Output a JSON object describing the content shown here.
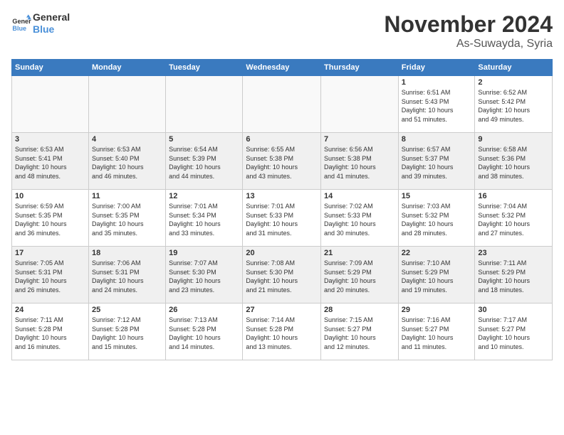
{
  "header": {
    "logo_line1": "General",
    "logo_line2": "Blue",
    "month_title": "November 2024",
    "subtitle": "As-Suwayda, Syria"
  },
  "days_of_week": [
    "Sunday",
    "Monday",
    "Tuesday",
    "Wednesday",
    "Thursday",
    "Friday",
    "Saturday"
  ],
  "weeks": [
    [
      {
        "day": "",
        "info": ""
      },
      {
        "day": "",
        "info": ""
      },
      {
        "day": "",
        "info": ""
      },
      {
        "day": "",
        "info": ""
      },
      {
        "day": "",
        "info": ""
      },
      {
        "day": "1",
        "info": "Sunrise: 6:51 AM\nSunset: 5:43 PM\nDaylight: 10 hours\nand 51 minutes."
      },
      {
        "day": "2",
        "info": "Sunrise: 6:52 AM\nSunset: 5:42 PM\nDaylight: 10 hours\nand 49 minutes."
      }
    ],
    [
      {
        "day": "3",
        "info": "Sunrise: 6:53 AM\nSunset: 5:41 PM\nDaylight: 10 hours\nand 48 minutes."
      },
      {
        "day": "4",
        "info": "Sunrise: 6:53 AM\nSunset: 5:40 PM\nDaylight: 10 hours\nand 46 minutes."
      },
      {
        "day": "5",
        "info": "Sunrise: 6:54 AM\nSunset: 5:39 PM\nDaylight: 10 hours\nand 44 minutes."
      },
      {
        "day": "6",
        "info": "Sunrise: 6:55 AM\nSunset: 5:38 PM\nDaylight: 10 hours\nand 43 minutes."
      },
      {
        "day": "7",
        "info": "Sunrise: 6:56 AM\nSunset: 5:38 PM\nDaylight: 10 hours\nand 41 minutes."
      },
      {
        "day": "8",
        "info": "Sunrise: 6:57 AM\nSunset: 5:37 PM\nDaylight: 10 hours\nand 39 minutes."
      },
      {
        "day": "9",
        "info": "Sunrise: 6:58 AM\nSunset: 5:36 PM\nDaylight: 10 hours\nand 38 minutes."
      }
    ],
    [
      {
        "day": "10",
        "info": "Sunrise: 6:59 AM\nSunset: 5:35 PM\nDaylight: 10 hours\nand 36 minutes."
      },
      {
        "day": "11",
        "info": "Sunrise: 7:00 AM\nSunset: 5:35 PM\nDaylight: 10 hours\nand 35 minutes."
      },
      {
        "day": "12",
        "info": "Sunrise: 7:01 AM\nSunset: 5:34 PM\nDaylight: 10 hours\nand 33 minutes."
      },
      {
        "day": "13",
        "info": "Sunrise: 7:01 AM\nSunset: 5:33 PM\nDaylight: 10 hours\nand 31 minutes."
      },
      {
        "day": "14",
        "info": "Sunrise: 7:02 AM\nSunset: 5:33 PM\nDaylight: 10 hours\nand 30 minutes."
      },
      {
        "day": "15",
        "info": "Sunrise: 7:03 AM\nSunset: 5:32 PM\nDaylight: 10 hours\nand 28 minutes."
      },
      {
        "day": "16",
        "info": "Sunrise: 7:04 AM\nSunset: 5:32 PM\nDaylight: 10 hours\nand 27 minutes."
      }
    ],
    [
      {
        "day": "17",
        "info": "Sunrise: 7:05 AM\nSunset: 5:31 PM\nDaylight: 10 hours\nand 26 minutes."
      },
      {
        "day": "18",
        "info": "Sunrise: 7:06 AM\nSunset: 5:31 PM\nDaylight: 10 hours\nand 24 minutes."
      },
      {
        "day": "19",
        "info": "Sunrise: 7:07 AM\nSunset: 5:30 PM\nDaylight: 10 hours\nand 23 minutes."
      },
      {
        "day": "20",
        "info": "Sunrise: 7:08 AM\nSunset: 5:30 PM\nDaylight: 10 hours\nand 21 minutes."
      },
      {
        "day": "21",
        "info": "Sunrise: 7:09 AM\nSunset: 5:29 PM\nDaylight: 10 hours\nand 20 minutes."
      },
      {
        "day": "22",
        "info": "Sunrise: 7:10 AM\nSunset: 5:29 PM\nDaylight: 10 hours\nand 19 minutes."
      },
      {
        "day": "23",
        "info": "Sunrise: 7:11 AM\nSunset: 5:29 PM\nDaylight: 10 hours\nand 18 minutes."
      }
    ],
    [
      {
        "day": "24",
        "info": "Sunrise: 7:11 AM\nSunset: 5:28 PM\nDaylight: 10 hours\nand 16 minutes."
      },
      {
        "day": "25",
        "info": "Sunrise: 7:12 AM\nSunset: 5:28 PM\nDaylight: 10 hours\nand 15 minutes."
      },
      {
        "day": "26",
        "info": "Sunrise: 7:13 AM\nSunset: 5:28 PM\nDaylight: 10 hours\nand 14 minutes."
      },
      {
        "day": "27",
        "info": "Sunrise: 7:14 AM\nSunset: 5:28 PM\nDaylight: 10 hours\nand 13 minutes."
      },
      {
        "day": "28",
        "info": "Sunrise: 7:15 AM\nSunset: 5:27 PM\nDaylight: 10 hours\nand 12 minutes."
      },
      {
        "day": "29",
        "info": "Sunrise: 7:16 AM\nSunset: 5:27 PM\nDaylight: 10 hours\nand 11 minutes."
      },
      {
        "day": "30",
        "info": "Sunrise: 7:17 AM\nSunset: 5:27 PM\nDaylight: 10 hours\nand 10 minutes."
      }
    ]
  ]
}
